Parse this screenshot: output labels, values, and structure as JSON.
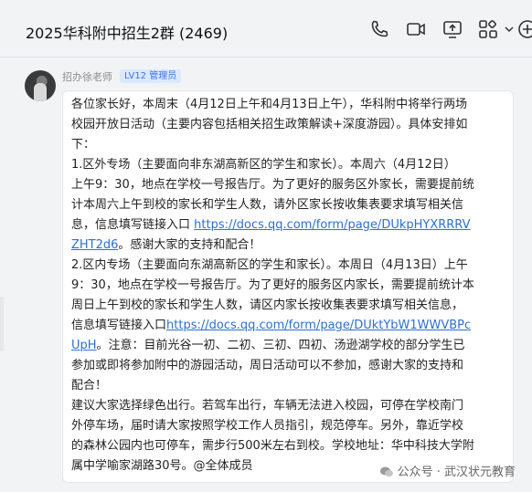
{
  "header": {
    "title": "2025华科附中招生2群 (2469)",
    "icons": [
      "phone-icon",
      "video-icon",
      "screen-share-icon",
      "apps-icon",
      "chevron-down-icon",
      "add-icon"
    ]
  },
  "message": {
    "sender": "招办徐老师",
    "badge": "LV12 管理员",
    "lines": [
      {
        "parts": [
          {
            "text": "各位家长好，本周末（4月12日上午和4月13日上午），华科附中将举行两场"
          }
        ]
      },
      {
        "parts": [
          {
            "text": "校园开放日活动（主要内容包括相关招生政策解读+深度游园）。具体安排如"
          }
        ]
      },
      {
        "parts": [
          {
            "text": "下："
          }
        ]
      },
      {
        "parts": [
          {
            "text": "    1.区外专场（主要面向非东湖高新区的学生和家长）。本周六（4月12日）"
          }
        ]
      },
      {
        "parts": [
          {
            "text": "上午9：30，地点在学校一号报告厅。为了更好的服务区外家长，需要提前统"
          }
        ]
      },
      {
        "parts": [
          {
            "text": "计本周六上午到校的家长和学生人数，请外区家长按收集表要求填写相关信"
          }
        ]
      },
      {
        "parts": [
          {
            "text": "息，信息填写链接入口 "
          },
          {
            "text": "https://docs.qq.com/form/page/DUkpHYXRRRV",
            "link": true
          }
        ]
      },
      {
        "parts": [
          {
            "text": "ZHT2d6",
            "link": true
          },
          {
            "text": "。感谢大家的支持和配合！"
          }
        ]
      },
      {
        "parts": [
          {
            "text": "2.区内专场（主要面向东湖高新区的学生和家长）。本周日（4月13日）上午"
          }
        ]
      },
      {
        "parts": [
          {
            "text": "9：30，地点在学校一号报告厅。为了更好的服务区内家长，需要提前统计本"
          }
        ]
      },
      {
        "parts": [
          {
            "text": "周日上午到校的家长和学生人数，请区内家长按收集表要求填写相关信息，"
          }
        ]
      },
      {
        "parts": [
          {
            "text": "信息填写链接入口"
          },
          {
            "text": "https://docs.qq.com/form/page/DUktYbW1WWVBPc",
            "link": true
          }
        ]
      },
      {
        "parts": [
          {
            "text": "UpH",
            "link": true
          },
          {
            "text": "。注意：目前光谷一初、二初、三初、四初、汤逊湖学校的部分学生已"
          }
        ]
      },
      {
        "parts": [
          {
            "text": "参加或即将参加附中的游园活动，周日活动可以不参加，感谢大家的支持和"
          }
        ]
      },
      {
        "parts": [
          {
            "text": "配合！"
          }
        ]
      },
      {
        "parts": [
          {
            "text": "建议大家选择绿色出行。若驾车出行，车辆无法进入校园，可停在学校南门"
          }
        ]
      },
      {
        "parts": [
          {
            "text": "外停车场，届时请大家按照学校工作人员指引，规范停车。另外，靠近学校"
          }
        ]
      },
      {
        "parts": [
          {
            "text": "的森林公园内也可停车，需步行500米左右到校。学校地址：华中科技大学附"
          }
        ]
      },
      {
        "parts": [
          {
            "text": "属中学喻家湖路30号。@全体成员"
          }
        ]
      }
    ]
  },
  "watermark": {
    "text": "公众号 · 武汉状元教育"
  }
}
